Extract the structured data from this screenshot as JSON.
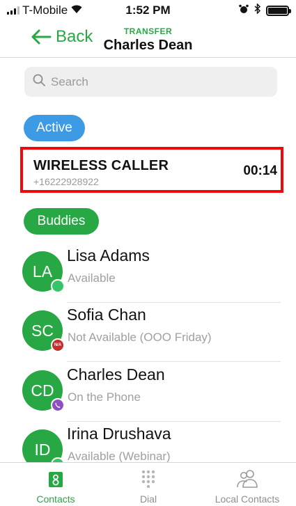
{
  "status_bar": {
    "carrier": "T-Mobile",
    "time": "1:52 PM"
  },
  "nav": {
    "back_label": "Back",
    "subtitle": "TRANSFER",
    "title": "Charles Dean"
  },
  "search": {
    "placeholder": "Search"
  },
  "sections": {
    "active_label": "Active",
    "buddies_label": "Buddies"
  },
  "active_call": {
    "name": "WIRELESS CALLER",
    "number": "+16222928922",
    "duration": "00:14"
  },
  "buddies": [
    {
      "initials": "LA",
      "name": "Lisa Adams",
      "status": "Available",
      "presence": "available"
    },
    {
      "initials": "SC",
      "name": "Sofia Chan",
      "status": "Not Available (OOO Friday)",
      "presence": "not-available",
      "presence_badge": "N/A"
    },
    {
      "initials": "CD",
      "name": "Charles Dean",
      "status": "On the Phone",
      "presence": "on-phone"
    },
    {
      "initials": "ID",
      "name": "Irina Drushava",
      "status": "Available (Webinar)",
      "presence": "available"
    }
  ],
  "tabs": [
    {
      "label": "Contacts",
      "icon": "contacts-icon",
      "selected": true
    },
    {
      "label": "Dial",
      "icon": "dialpad-icon",
      "selected": false
    },
    {
      "label": "Local Contacts",
      "icon": "local-contacts-icon",
      "selected": false
    }
  ],
  "colors": {
    "accent_green": "#27a844",
    "active_blue": "#3d9ae4",
    "highlight_red": "#ee0a0a",
    "presence_available": "#35c46a",
    "presence_not_available": "#c72d2d",
    "presence_on_phone": "#8e4fc2"
  }
}
